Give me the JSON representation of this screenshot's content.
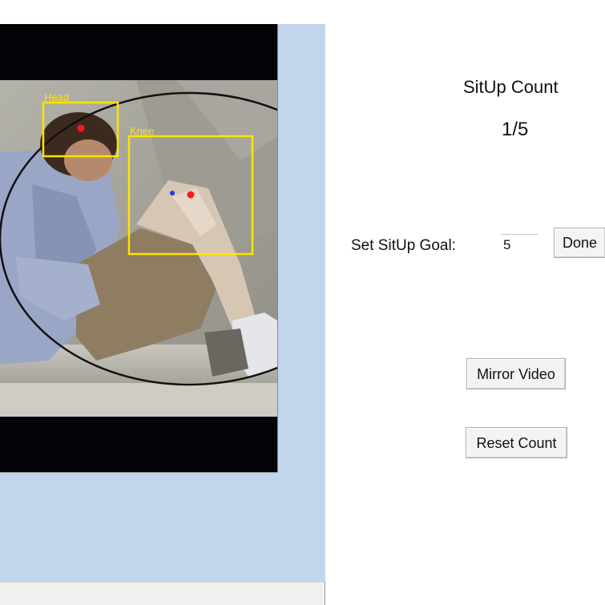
{
  "video": {
    "head_label": "Head",
    "knee_label": "Knee",
    "box_color": "#ffe400",
    "point_color_red": "#ff1a1a",
    "point_color_blue": "#1a3cff"
  },
  "counter": {
    "title": "SitUp Count",
    "value": "1/5"
  },
  "goal": {
    "label": "Set SitUp Goal:",
    "value": "5",
    "done_label": "Done"
  },
  "controls": {
    "mirror_label": "Mirror Video",
    "reset_label": "Reset Count"
  },
  "colors": {
    "panel_bg": "#c3d5ec",
    "video_letterbox": "#050308"
  }
}
